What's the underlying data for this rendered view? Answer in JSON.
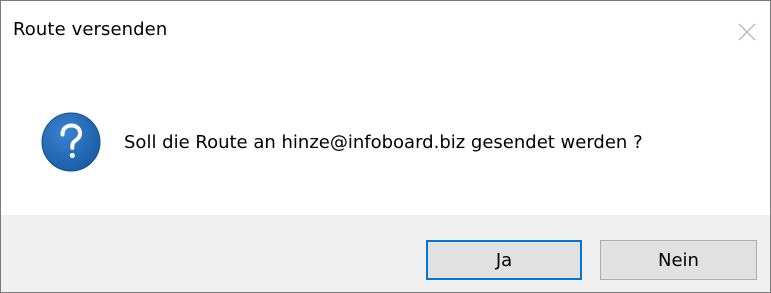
{
  "window": {
    "title": "Route versenden"
  },
  "dialog": {
    "icon": "question-icon",
    "message": "Soll die Route an hinze@infoboard.biz gesendet werden ?"
  },
  "buttons": {
    "yes_label": "Ja",
    "no_label": "Nein"
  },
  "colors": {
    "icon_blue": "#1a5fa8",
    "focus_border": "#0078d7",
    "footer_bg": "#f0f0f0",
    "button_bg": "#e1e1e1"
  }
}
